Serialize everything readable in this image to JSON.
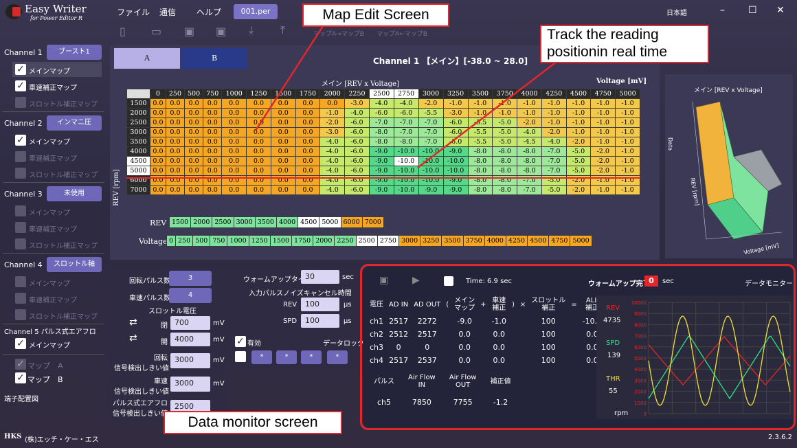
{
  "app": {
    "title": "Easy Writer",
    "subtitle": "for Power Editor R",
    "version": "2.3.6.2",
    "company": "(株)エッチ・ケー・エス",
    "logo_text": "HKS"
  },
  "menu": {
    "file": "ファイル",
    "comm": "通信",
    "help": "ヘルプ",
    "file_tab": "001.per",
    "language": "日本語",
    "map_ab": "マップA→マップB",
    "map_ba": "マップA←マップB"
  },
  "window": {
    "minimize": "–",
    "maximize": "☐",
    "close": "✕"
  },
  "sidebar": {
    "channels": [
      {
        "label": "Channel 1",
        "select": "ブースト1",
        "items": [
          {
            "label": "メインマップ",
            "checked": true,
            "enabled": true
          },
          {
            "label": "車速補正マップ",
            "checked": true,
            "enabled": true
          },
          {
            "label": "スロットル補正マップ",
            "checked": false,
            "enabled": false
          }
        ]
      },
      {
        "label": "Channel 2",
        "select": "インマニ圧",
        "items": [
          {
            "label": "メインマップ",
            "checked": true,
            "enabled": true
          },
          {
            "label": "車速補正マップ",
            "checked": false,
            "enabled": false
          },
          {
            "label": "スロットル補正マップ",
            "checked": false,
            "enabled": false
          }
        ]
      },
      {
        "label": "Channel 3",
        "select": "未使用",
        "items": [
          {
            "label": "メインマップ",
            "checked": false,
            "enabled": false
          },
          {
            "label": "車速補正マップ",
            "checked": false,
            "enabled": false
          },
          {
            "label": "スロットル補正マップ",
            "checked": false,
            "enabled": false
          }
        ]
      },
      {
        "label": "Channel 4",
        "select": "スロットル軸",
        "items": [
          {
            "label": "メインマップ",
            "checked": false,
            "enabled": false
          },
          {
            "label": "車速補正マップ",
            "checked": false,
            "enabled": false
          },
          {
            "label": "スロットル補正マップ",
            "checked": false,
            "enabled": false
          }
        ]
      }
    ],
    "ch5_label": "Channel 5 パルス式エアフロ",
    "ch5_item": "メインマップ",
    "mapA": "マップ　A",
    "mapB": "マップ　B",
    "pin": "端子配置図"
  },
  "tabs": {
    "a": "A",
    "b": "B"
  },
  "map": {
    "channel_title": "Channel 1 【メイン】[-38.0 ~ 28.0]",
    "title": "メイン [REV x Voltage]",
    "voltage_label": "Voltage [mV]",
    "rev_label": "REV [rpm]",
    "cols": [
      "0",
      "250",
      "500",
      "750",
      "1000",
      "1250",
      "1500",
      "1750",
      "2000",
      "2250",
      "2500",
      "2750",
      "3000",
      "3250",
      "3500",
      "3750",
      "4000",
      "4250",
      "4500",
      "4750",
      "5000"
    ],
    "rows": [
      {
        "rev": "1500",
        "v": [
          "0.0",
          "0.0",
          "0.0",
          "0.0",
          "0.0",
          "0.0",
          "0.0",
          "0.0",
          "0.0",
          "-3.0",
          "-4.0",
          "-4.0",
          "-2.0",
          "-1.0",
          "-1.0",
          "-1.0",
          "-1.0",
          "-1.0",
          "-1.0",
          "-1.0",
          "-1.0"
        ]
      },
      {
        "rev": "2000",
        "v": [
          "0.0",
          "0.0",
          "0.0",
          "0.0",
          "0.0",
          "0.0",
          "0.0",
          "0.0",
          "-1.0",
          "-4.0",
          "-6.0",
          "-6.0",
          "-5.5",
          "-3.0",
          "-1.0",
          "-1.0",
          "-1.0",
          "-1.0",
          "-1.0",
          "-1.0",
          "-1.0"
        ]
      },
      {
        "rev": "2500",
        "v": [
          "0.0",
          "0.0",
          "0.0",
          "0.0",
          "0.0",
          "0.0",
          "0.0",
          "0.0",
          "-2.0",
          "-6.0",
          "-7.0",
          "-7.0",
          "-7.0",
          "-6.0",
          "-5.5",
          "-5.0",
          "-2.0",
          "-1.0",
          "-1.0",
          "-1.0",
          "-1.0"
        ]
      },
      {
        "rev": "3000",
        "v": [
          "0.0",
          "0.0",
          "0.0",
          "0.0",
          "0.0",
          "0.0",
          "0.0",
          "0.0",
          "-3.0",
          "-6.0",
          "-8.0",
          "-7.0",
          "-7.0",
          "-6.0",
          "-5.5",
          "-5.0",
          "-4.0",
          "-2.0",
          "-1.0",
          "-1.0",
          "-1.0"
        ]
      },
      {
        "rev": "3500",
        "v": [
          "0.0",
          "0.0",
          "0.0",
          "0.0",
          "0.0",
          "0.0",
          "0.0",
          "0.0",
          "-4.0",
          "-6.0",
          "-8.0",
          "-8.0",
          "-7.0",
          "-6.0",
          "-5.5",
          "-5.0",
          "-4.5",
          "-4.0",
          "-2.0",
          "-1.0",
          "-1.0"
        ]
      },
      {
        "rev": "4000",
        "v": [
          "0.0",
          "0.0",
          "0.0",
          "0.0",
          "0.0",
          "0.0",
          "0.0",
          "0.0",
          "-4.0",
          "-6.0",
          "-9.0",
          "-10.0",
          "-10.0",
          "-9.0",
          "-8.0",
          "-8.0",
          "-8.0",
          "-7.0",
          "-5.0",
          "-2.0",
          "-1.0"
        ]
      },
      {
        "rev": "4500",
        "v": [
          "0.0",
          "0.0",
          "0.0",
          "0.0",
          "0.0",
          "0.0",
          "0.0",
          "0.0",
          "-4.0",
          "-6.0",
          "-9.0",
          "-10.0",
          "-10.0",
          "-10.0",
          "-8.0",
          "-8.0",
          "-8.0",
          "-7.0",
          "-5.0",
          "-2.0",
          "-1.0"
        ]
      },
      {
        "rev": "5000",
        "v": [
          "0.0",
          "0.0",
          "0.0",
          "0.0",
          "0.0",
          "0.0",
          "0.0",
          "0.0",
          "-4.0",
          "-6.0",
          "-9.0",
          "-10.0",
          "-10.0",
          "-10.0",
          "-8.0",
          "-8.0",
          "-8.0",
          "-7.0",
          "-5.0",
          "-2.0",
          "-1.0"
        ]
      },
      {
        "rev": "6000",
        "v": [
          "0.0",
          "0.0",
          "0.0",
          "0.0",
          "0.0",
          "0.0",
          "0.0",
          "0.0",
          "-4.0",
          "-6.0",
          "-9.0",
          "-10.0",
          "-10.0",
          "-9.0",
          "-8.0",
          "-8.0",
          "-7.0",
          "-5.0",
          "-2.0",
          "-1.0",
          "-1.0"
        ]
      },
      {
        "rev": "7000",
        "v": [
          "0.0",
          "0.0",
          "0.0",
          "0.0",
          "0.0",
          "0.0",
          "0.0",
          "0.0",
          "-4.0",
          "-6.0",
          "-9.0",
          "-10.0",
          "-9.0",
          "-9.0",
          "-8.0",
          "-8.0",
          "-7.0",
          "-5.0",
          "-2.0",
          "-1.0",
          "-1.0"
        ]
      }
    ],
    "rev_strip_label": "REV",
    "rev_strip": [
      "1500",
      "2000",
      "2500",
      "3000",
      "3500",
      "4000",
      "4500",
      "5000",
      "6000",
      "7000"
    ],
    "volt_strip_label": "Voltage",
    "volt_strip": [
      "0",
      "250",
      "500",
      "750",
      "1000",
      "1250",
      "1500",
      "1750",
      "2000",
      "2250",
      "2500",
      "2750",
      "3000",
      "3250",
      "3500",
      "3750",
      "4000",
      "4250",
      "4500",
      "4750",
      "5000"
    ]
  },
  "graph3d": {
    "title": "メイン [REV x Voltage]",
    "data_label": "Data",
    "rev_axis": "REV [rpm]",
    "volt_axis": "Voltage [mV]"
  },
  "settings": {
    "rot_pulse_label": "回転パルス数",
    "rot_pulse": "3",
    "spd_pulse_label": "車速パルス数",
    "spd_pulse": "4",
    "thr_v_label": "スロットル電圧",
    "close_label": "閉",
    "close_val": "700",
    "open_label": "開",
    "open_val": "4000",
    "mv": "mV",
    "rot_thresh_label": "回転\n信号検出しきい値",
    "rot_thresh": "3000",
    "spd_thresh_label": "車速\n信号検出しきい値",
    "spd_thresh": "3000",
    "af_thresh_label": "パルス式エアフロ\n信号検出しきい値",
    "af_thresh": "2500",
    "warmup_label": "ウォームアップタイム",
    "warmup": "30",
    "sec": "sec",
    "noise_label": "入力パルスノイズキャンセル時間",
    "rev_label": "REV",
    "rev_val": "100",
    "spd_label": "SPD",
    "spd_val": "100",
    "us": "µs",
    "valid": "有効",
    "datalock": "データロック",
    "star": "*"
  },
  "monitor": {
    "time": "Time: 6.9 sec",
    "warmup_done": "ウォームアップ完了",
    "warmup_count": "0",
    "sec": "sec",
    "title": "データモニター",
    "headers": [
      "電圧",
      "AD IN",
      "AD OUT",
      "(",
      "メイン\nマップ",
      "+",
      "車速\n補正",
      ")",
      "×",
      "スロットル\n補正",
      "=",
      "ALL\n補正"
    ],
    "rows": [
      [
        "ch1",
        "2517",
        "2272",
        "",
        "-9.0",
        "",
        "-1.0",
        "",
        "",
        "100",
        "",
        "-10.0"
      ],
      [
        "ch2",
        "2512",
        "2517",
        "",
        "0.0",
        "",
        "0.0",
        "",
        "",
        "100",
        "",
        "0.0"
      ],
      [
        "ch3",
        "0",
        "0",
        "",
        "0.0",
        "",
        "0.0",
        "",
        "",
        "100",
        "",
        "0.0"
      ],
      [
        "ch4",
        "2517",
        "2537",
        "",
        "0.0",
        "",
        "0.0",
        "",
        "",
        "100",
        "",
        "0.0"
      ]
    ],
    "pulse_headers": [
      "パルス",
      "Air Flow\nIN",
      "Air Flow\nOUT",
      "補正値"
    ],
    "pulse_row": [
      "ch5",
      "7850",
      "7755",
      "-1.2"
    ],
    "rev_label": "REV",
    "rev_value": "4735",
    "spd_label": "SPD",
    "spd_value": "139",
    "thr_label": "THR",
    "thr_value": "55",
    "unit": "rpm",
    "y_ticks": [
      "10000",
      "9000",
      "8000",
      "7000",
      "6000",
      "5000",
      "4000",
      "3000",
      "2000",
      "1000",
      "0"
    ]
  },
  "annotations": {
    "map_edit": "Map Edit Screen",
    "track": "Track the reading\npositionin real time",
    "data_monitor": "Data monitor screen"
  },
  "colors": {
    "accent": "#6f68b8",
    "annotation": "#e3262b",
    "cell_orange": "#f5a623",
    "cell_yellow": "#f2c94c",
    "cell_green": "#7fe3a0"
  }
}
